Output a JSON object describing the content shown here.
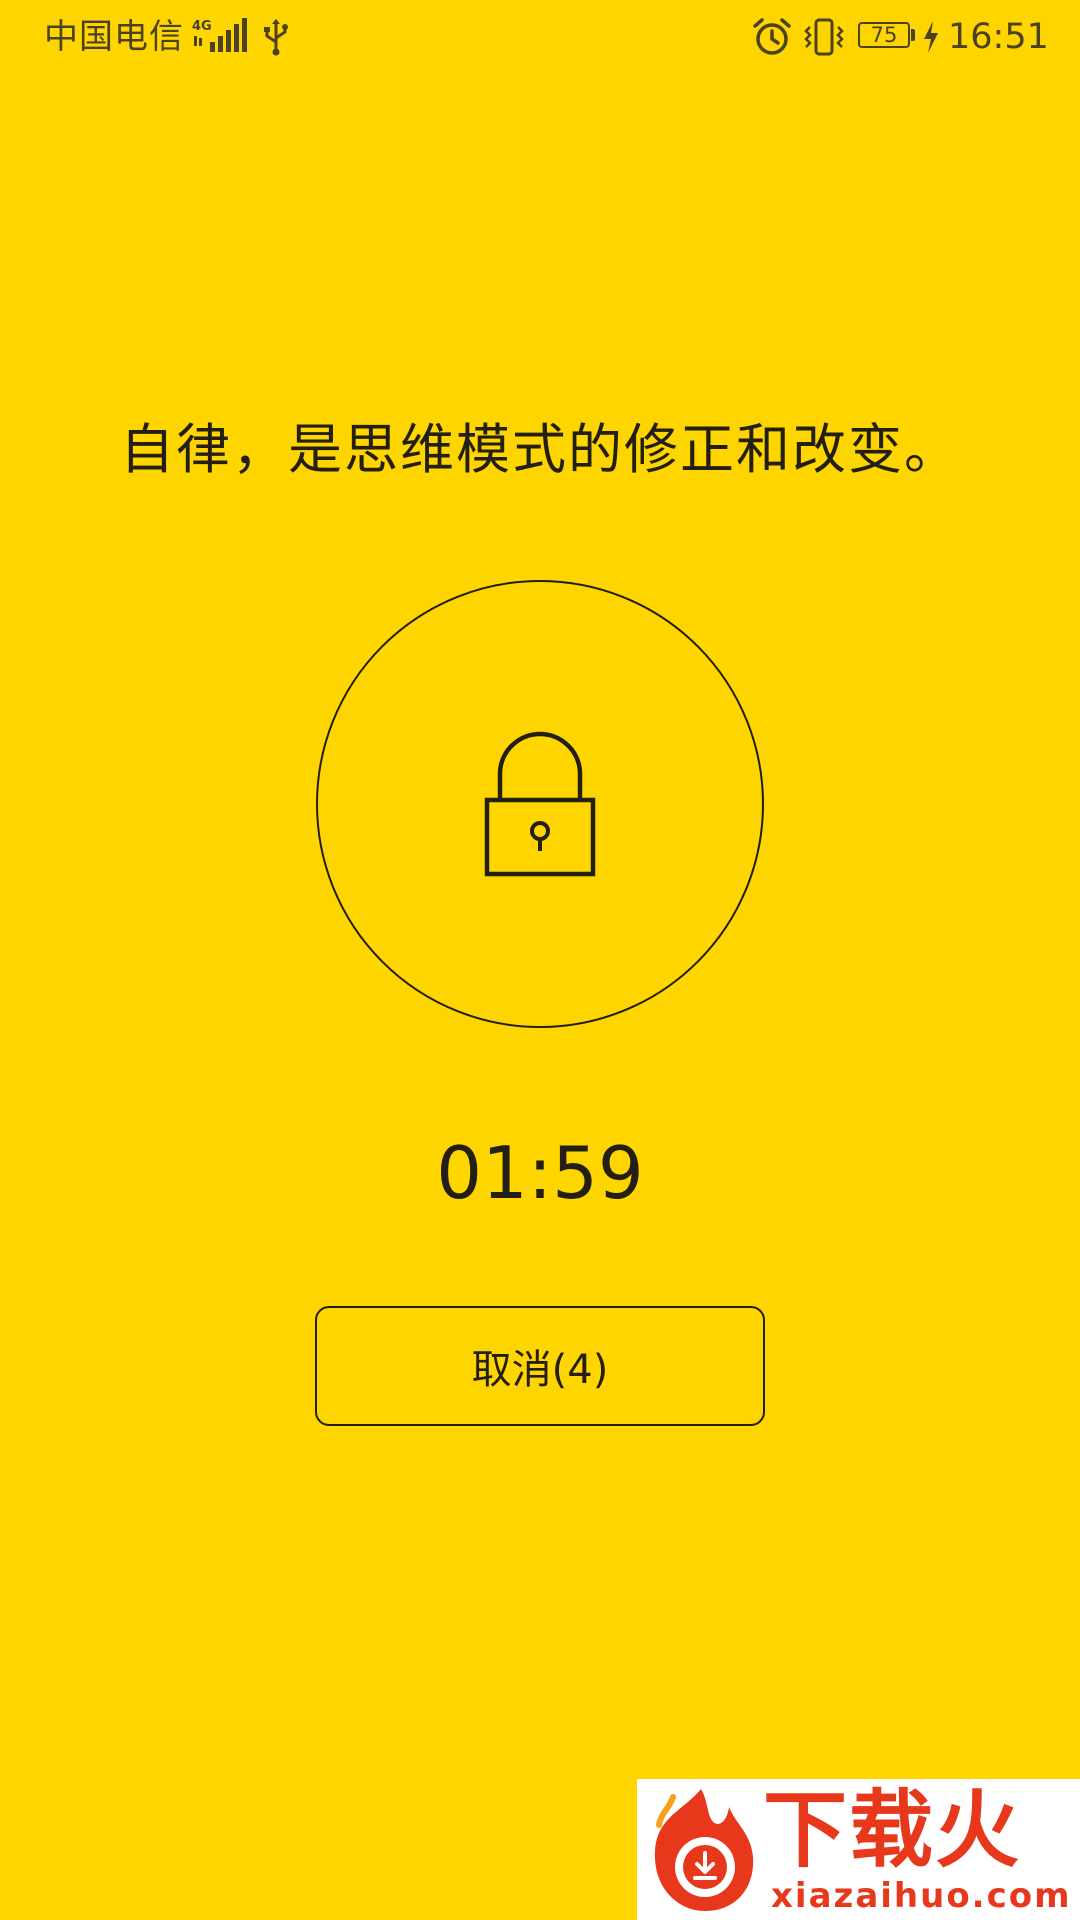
{
  "status_bar": {
    "carrier": "中国电信",
    "network_type": "4G",
    "battery_level": "75",
    "time": "16:51",
    "icons": [
      "signal-icon",
      "usb-icon",
      "alarm-icon",
      "vibrate-icon",
      "battery-icon",
      "charging-icon"
    ]
  },
  "main": {
    "quote": "自律，是思维模式的修正和改变。",
    "lock_icon": "lock-icon",
    "timer": "01:59",
    "cancel_label": "取消(4)"
  },
  "watermark": {
    "name": "下载火",
    "url": "xiazaihuo.com"
  },
  "colors": {
    "background": "#FFD500",
    "foreground": "#231f14",
    "watermark_accent": "#E8381C"
  }
}
